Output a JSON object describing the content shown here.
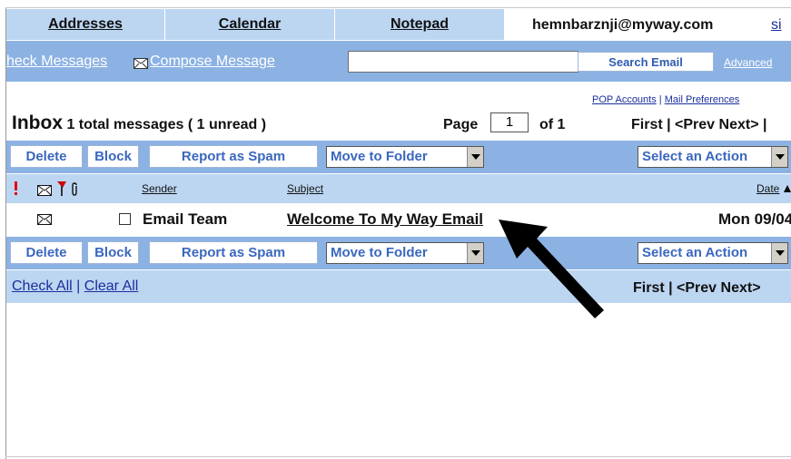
{
  "tabs": [
    {
      "label": "Addresses"
    },
    {
      "label": "Calendar"
    },
    {
      "label": "Notepad"
    }
  ],
  "user": {
    "email": "hemnbarznji@myway.com",
    "signout_fragment": "si"
  },
  "toolbar": {
    "check_messages": "heck Messages",
    "compose_message": "Compose Message",
    "search_value": "",
    "search_button": "Search Email",
    "advanced": "Advanced"
  },
  "links": {
    "pop_accounts": "POP Accounts",
    "separator": "|",
    "mail_preferences": "Mail Preferences"
  },
  "inbox": {
    "title": "Inbox",
    "count_text": "1 total messages ( 1 unread )",
    "page_label": "Page",
    "page_value": "1",
    "page_of": "of 1",
    "pager": "First | <Prev Next> |"
  },
  "actions": {
    "delete": "Delete",
    "block": "Block",
    "report_spam": "Report as Spam",
    "move_to_folder": "Move to Folder",
    "select_action": "Select an Action"
  },
  "columns": {
    "sender": "Sender",
    "subject": "Subject",
    "date": "Date"
  },
  "messages": [
    {
      "sender": "Email Team",
      "subject": "Welcome To My Way Email",
      "date": "Mon 09/04"
    }
  ],
  "footer": {
    "check_all": "Check All",
    "separator": "|",
    "clear_all": "Clear All",
    "pager": "First | <Prev Next>"
  },
  "colors": {
    "accent_dark": "#8cb2e3",
    "accent_light": "#bcd6f2",
    "button_text": "#3a67bf",
    "link": "#1a2f9c"
  }
}
